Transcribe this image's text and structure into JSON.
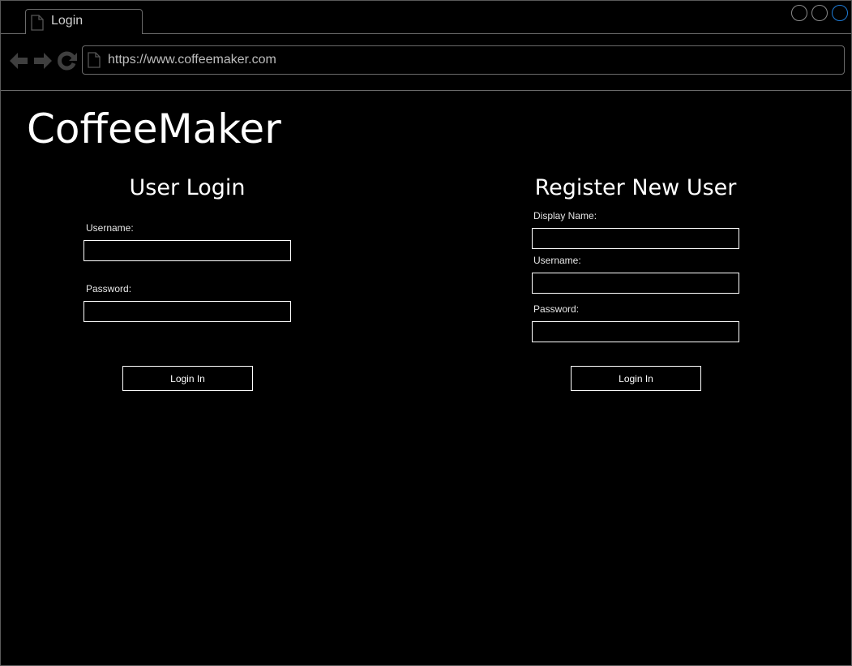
{
  "browser": {
    "tab_title": "Login",
    "url": "https://www.coffeemaker.com",
    "nav_color": "#3f3f3f",
    "active_control_color": "#1e7bd6"
  },
  "page": {
    "app_title": "CoffeeMaker"
  },
  "login": {
    "heading": "User Login",
    "username_label": "Username:",
    "username_value": "",
    "password_label": "Password:",
    "password_value": "",
    "submit_label": "Login In"
  },
  "register": {
    "heading": "Register New User",
    "display_name_label": "Display Name:",
    "display_name_value": "",
    "username_label": "Username:",
    "username_value": "",
    "password_label": "Password:",
    "password_value": "",
    "submit_label": "Login In"
  }
}
